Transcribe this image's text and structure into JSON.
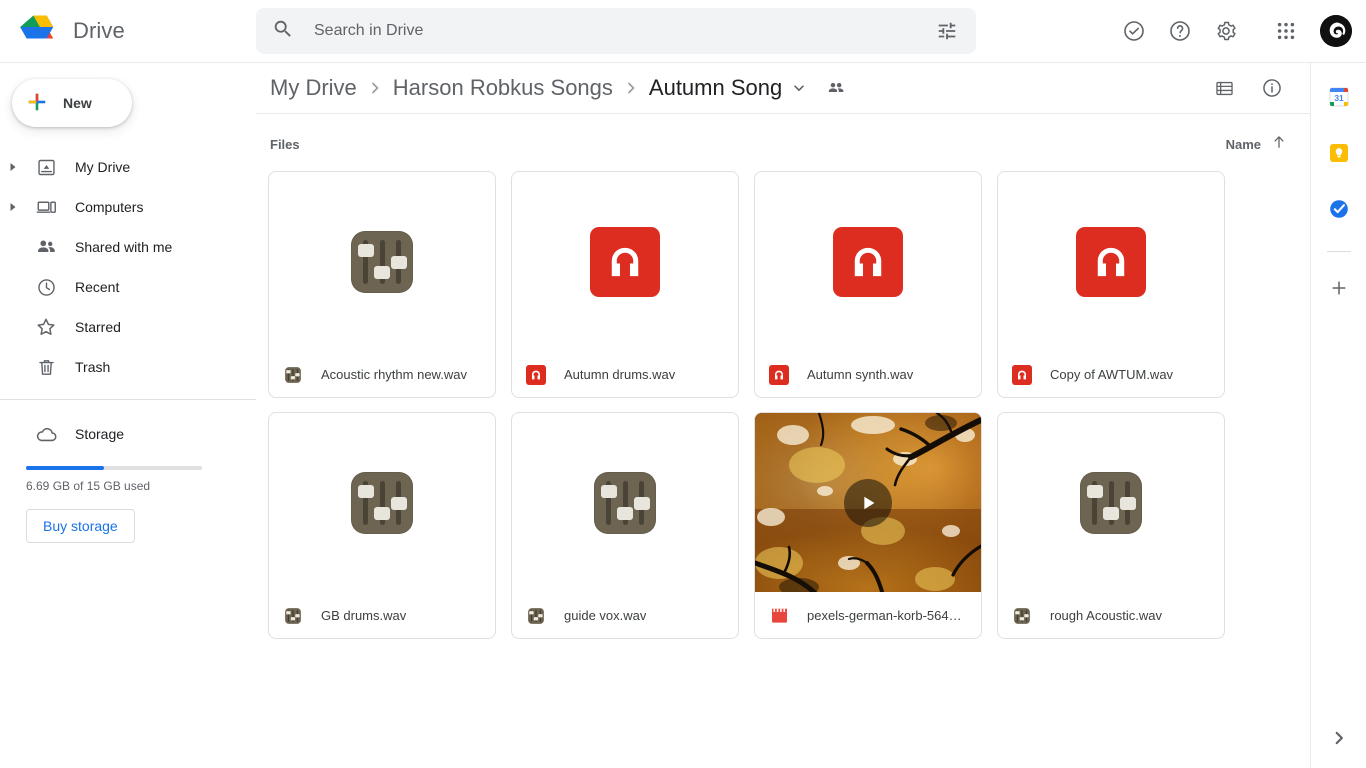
{
  "app": {
    "name": "Drive",
    "logo_colors": [
      "#0f9d58",
      "#fbbc04",
      "#1a73e8",
      "#ea4335"
    ]
  },
  "search": {
    "placeholder": "Search in Drive",
    "value": "",
    "icon": "search-icon",
    "options_icon": "tune-icon"
  },
  "top_actions": [
    {
      "name": "support-icon",
      "title": "Support"
    },
    {
      "name": "help-icon",
      "title": "Help"
    },
    {
      "name": "settings-gear-icon",
      "title": "Settings"
    },
    {
      "name": "apps-grid-icon",
      "title": "Google apps"
    }
  ],
  "account": {
    "avatar_icon": "avatar",
    "avatar_bg": "#111111"
  },
  "sidebar": {
    "new_button": {
      "label": "New",
      "icon": "plus-icon"
    },
    "items": [
      {
        "label": "My Drive",
        "icon": "my-drive-icon",
        "expandable": true
      },
      {
        "label": "Computers",
        "icon": "computers-icon",
        "expandable": true
      },
      {
        "label": "Shared with me",
        "icon": "shared-with-me-icon",
        "expandable": false
      },
      {
        "label": "Recent",
        "icon": "clock-icon",
        "expandable": false
      },
      {
        "label": "Starred",
        "icon": "star-icon",
        "expandable": false
      },
      {
        "label": "Trash",
        "icon": "trash-icon",
        "expandable": false
      }
    ],
    "storage": {
      "label": "Storage",
      "icon": "cloud-icon",
      "used_text": "6.69 GB of 15 GB used",
      "percent": 44.6,
      "bar_color": "#1a73e8",
      "buy_label": "Buy storage"
    }
  },
  "breadcrumb": {
    "items": [
      {
        "label": "My Drive"
      },
      {
        "label": "Harson Robkus Songs"
      },
      {
        "label": "Autumn Song"
      }
    ],
    "separator": "›",
    "dropdown_icon": "chevron-down-icon",
    "shared_icon": "people-shared-icon",
    "list_view_icon": "list-view-icon",
    "details_icon": "info-icon"
  },
  "main": {
    "section_label": "Files",
    "sort": {
      "label": "Name",
      "direction": "asc",
      "icon": "arrow-up-icon"
    },
    "files": [
      {
        "name": "Acoustic rhythm new.wav",
        "thumb": "audio-mixer",
        "badge": "audio-mixer-small"
      },
      {
        "name": "Autumn drums.wav",
        "thumb": "headphone-red",
        "badge": "headphone-red-small"
      },
      {
        "name": "Autumn synth.wav",
        "thumb": "headphone-red",
        "badge": "headphone-red-small"
      },
      {
        "name": "Copy of AWTUM.wav",
        "thumb": "headphone-red",
        "badge": "headphone-red-small"
      },
      {
        "name": "GB drums.wav",
        "thumb": "audio-mixer",
        "badge": "audio-mixer-small"
      },
      {
        "name": "guide vox.wav",
        "thumb": "audio-mixer",
        "badge": "audio-mixer-small"
      },
      {
        "name": "pexels-german-korb-5643…",
        "thumb": "video-autumn-trees",
        "badge": "video-red-small"
      },
      {
        "name": "rough Acoustic.wav",
        "thumb": "audio-mixer",
        "badge": "audio-mixer-small"
      }
    ]
  },
  "right_rail": {
    "items": [
      {
        "name": "google-calendar-icon",
        "label": "Calendar",
        "day": "31"
      },
      {
        "name": "google-keep-icon",
        "label": "Keep"
      },
      {
        "name": "google-tasks-icon",
        "label": "Tasks"
      }
    ],
    "add_label": "+",
    "expand_icon": "chevron-right-icon"
  }
}
